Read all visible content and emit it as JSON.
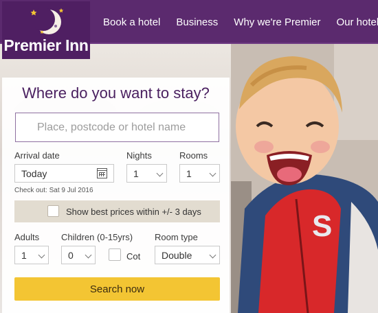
{
  "brand": {
    "name": "Premier Inn"
  },
  "nav": [
    {
      "label": "Book a hotel"
    },
    {
      "label": "Business"
    },
    {
      "label": "Why we're Premier"
    },
    {
      "label": "Our hotels"
    }
  ],
  "booking": {
    "title": "Where do you want to stay?",
    "search": {
      "placeholder": "Place, postcode or hotel name",
      "value": ""
    },
    "arrival": {
      "label": "Arrival date",
      "value": "Today"
    },
    "nights": {
      "label": "Nights",
      "value": "1"
    },
    "rooms": {
      "label": "Rooms",
      "value": "1"
    },
    "checkout": "Check out: Sat 9 Jul 2016",
    "best_prices": "Show best prices within +/- 3 days",
    "adults": {
      "label": "Adults",
      "value": "1"
    },
    "children": {
      "label": "Children (0-15yrs)",
      "value": "0"
    },
    "cot": "Cot",
    "room_type": {
      "label": "Room type",
      "value": "Double"
    },
    "search_button": "Search now"
  },
  "colors": {
    "header": "#5b2a6e",
    "logo_bg": "#4f1f62",
    "title": "#4a2060",
    "search_button": "#f3c533"
  },
  "icons": [
    "moon-logo-icon",
    "calendar-icon",
    "chevron-down-icon"
  ]
}
